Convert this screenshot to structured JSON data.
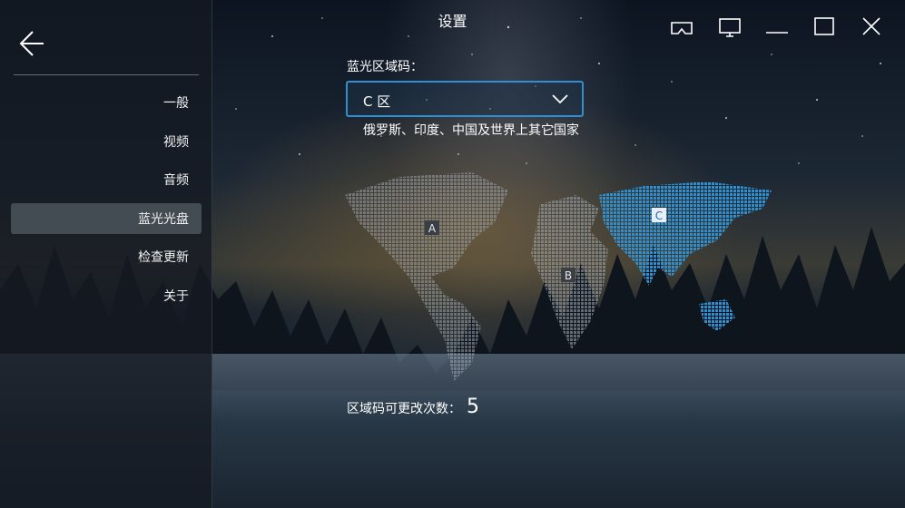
{
  "window": {
    "title": "设置"
  },
  "sidebar": {
    "items": [
      {
        "label": "一般"
      },
      {
        "label": "视频"
      },
      {
        "label": "音频"
      },
      {
        "label": "蓝光光盘"
      },
      {
        "label": "检查更新"
      },
      {
        "label": "关于"
      }
    ],
    "active_item": "蓝光光盘"
  },
  "main": {
    "region_label": "蓝光区域码：",
    "region_select": {
      "value": "C 区"
    },
    "region_description": "俄罗斯、印度、中国及世界上其它国家",
    "map_labels": {
      "a": "A",
      "b": "B",
      "c": "C"
    },
    "changes_label": "区域码可更改次数：",
    "changes_count": "5"
  },
  "colors": {
    "accent": "#2f8fd0",
    "region_highlight": "#2e8fd1",
    "region_dim": "#9aa3ad"
  },
  "icons": [
    "back-arrow-icon",
    "vr-headset-icon",
    "monitor-icon",
    "minimize-icon",
    "maximize-icon",
    "close-icon",
    "chevron-down-icon"
  ]
}
